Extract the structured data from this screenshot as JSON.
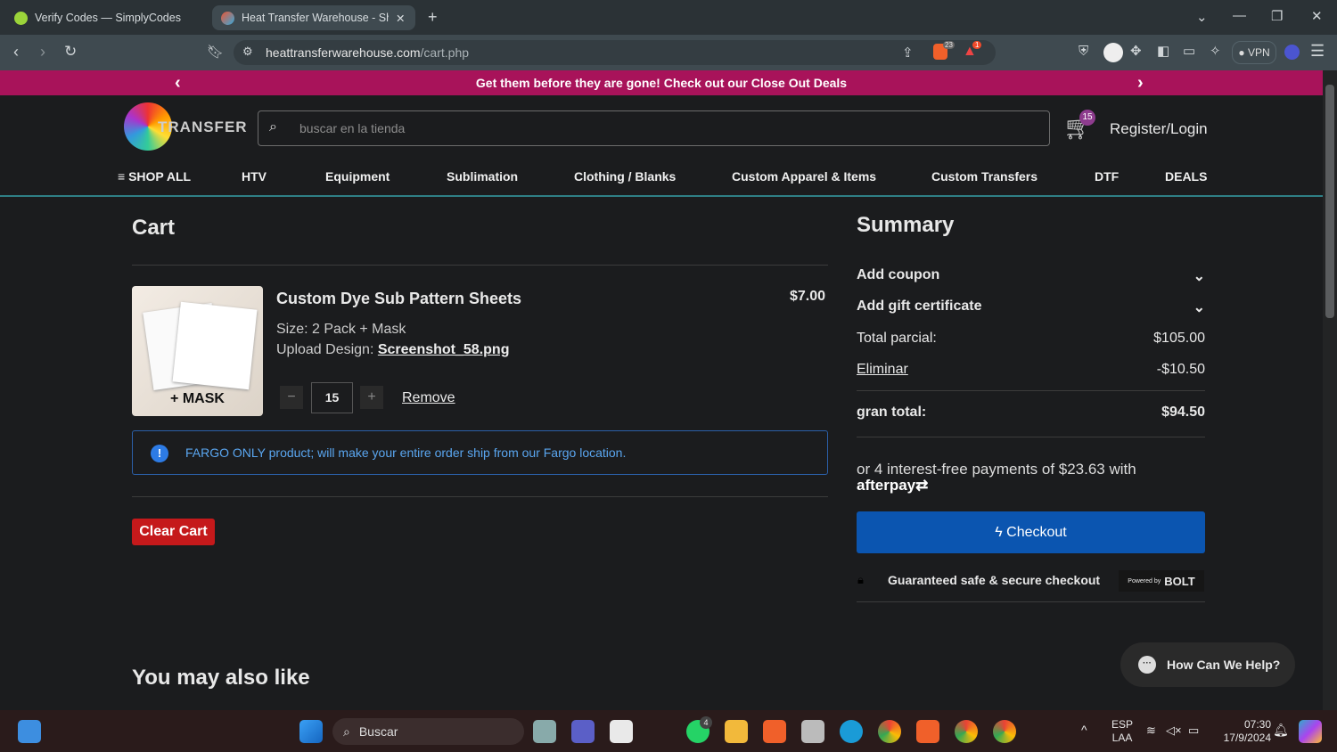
{
  "browser": {
    "tabs": [
      {
        "label": "Verify Codes — SimplyCodes"
      },
      {
        "label": "Heat Transfer Warehouse - Sho"
      }
    ],
    "url_domain": "heattransferwarehouse.com",
    "url_path": "/cart.php",
    "brave_count": "23",
    "alert_count": "1",
    "vpn": "VPN"
  },
  "promo": {
    "text": "Get them before they are gone! Check out our Close Out Deals"
  },
  "header": {
    "logo_text": "HEAT TRANSFER WAREHOUSE",
    "search_placeholder": "buscar en la tienda",
    "cart_count": "15",
    "login": "Register/Login"
  },
  "nav": [
    "SHOP ALL",
    "HTV",
    "Equipment",
    "Sublimation",
    "Clothing / Blanks",
    "Custom Apparel & Items",
    "Custom Transfers",
    "DTF",
    "DEALS"
  ],
  "cart": {
    "title": "Cart",
    "item": {
      "name": "Custom Dye Sub Pattern Sheets",
      "price": "$7.00",
      "size_label": "Size:",
      "size": "2 Pack + Mask",
      "upload_label": "Upload Design:",
      "upload_file": "Screenshot_58.png",
      "qty": "15",
      "remove": "Remove",
      "image_caption": "+ MASK"
    },
    "notice": "FARGO ONLY product; will make your entire order ship from our Fargo location.",
    "clear": "Clear Cart"
  },
  "summary": {
    "title": "Summary",
    "coupon": "Add coupon",
    "gift": "Add gift certificate",
    "subtotal_label": "Total parcial:",
    "subtotal": "$105.00",
    "discount_label": "Eliminar",
    "discount": "-$10.50",
    "total_label": "gran total:",
    "total": "$94.50",
    "afterpay_text": "or 4 interest-free payments of $23.63 with",
    "afterpay_brand": "afterpay",
    "checkout": "Checkout",
    "secure": "Guaranteed safe & secure checkout",
    "powered": "Powered by",
    "bolt": "BOLT"
  },
  "also_like": "You may also like",
  "chat": "How Can We Help?",
  "taskbar": {
    "search": "Buscar",
    "lang1": "ESP",
    "lang2": "LAA",
    "time": "07:30",
    "date": "17/9/2024",
    "whatsapp_badge": "4"
  }
}
